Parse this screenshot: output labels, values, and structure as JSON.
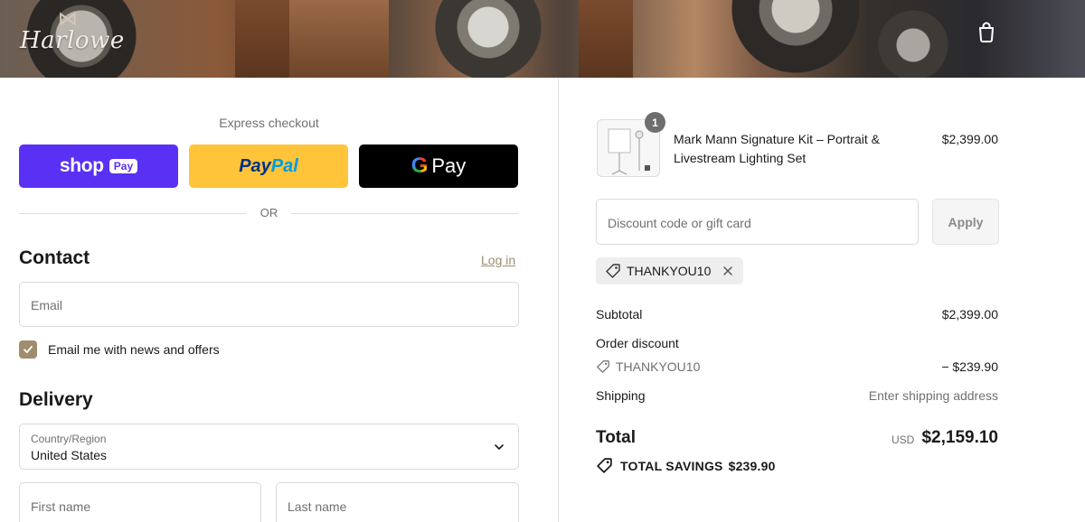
{
  "header": {
    "logo_text": "Harlowe"
  },
  "express": {
    "label": "Express checkout",
    "shop_pay": {
      "word": "shop",
      "tag": "Pay"
    },
    "paypal": {
      "part1": "Pay",
      "part2": "Pal"
    },
    "gpay": {
      "g": "G",
      "word": "Pay"
    },
    "or_text": "OR"
  },
  "contact": {
    "title": "Contact",
    "login_label": "Log in",
    "email_placeholder": "Email",
    "newsletter_label": "Email me with news and offers",
    "newsletter_checked": true
  },
  "delivery": {
    "title": "Delivery",
    "country_label": "Country/Region",
    "country_value": "United States",
    "first_name_placeholder": "First name",
    "last_name_placeholder": "Last name"
  },
  "summary": {
    "item": {
      "quantity": "1",
      "name": "Mark Mann Signature Kit – Portrait & Livestream Lighting Set",
      "price": "$2,399.00"
    },
    "discount_placeholder": "Discount code or gift card",
    "apply_label": "Apply",
    "applied_code": "THANKYOU10",
    "subtotal_label": "Subtotal",
    "subtotal_value": "$2,399.00",
    "order_discount_label": "Order discount",
    "order_discount_code": "THANKYOU10",
    "order_discount_value": "− $239.90",
    "shipping_label": "Shipping",
    "shipping_value": "Enter shipping address",
    "total_label": "Total",
    "currency": "USD",
    "total_value": "$2,159.10",
    "savings_label": "TOTAL SAVINGS",
    "savings_value": "$239.90"
  },
  "colors": {
    "shop_pay": "#5a31f4",
    "paypal": "#ffc439",
    "gpay": "#000000",
    "accent": "#a08c6e"
  },
  "icons": {
    "cart": "shopping-bag-icon",
    "chevron": "chevron-down-icon",
    "tag": "tag-icon",
    "close": "close-icon",
    "check": "check-icon"
  }
}
